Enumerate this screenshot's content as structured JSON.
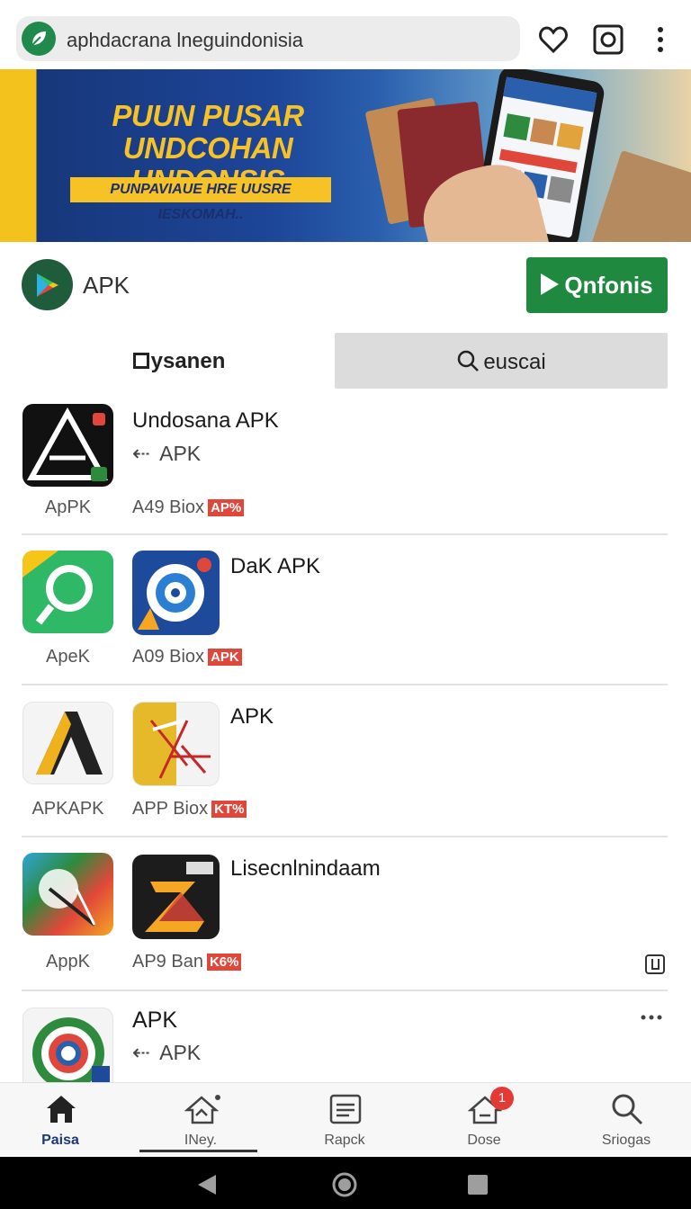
{
  "browser": {
    "url": "aphdacrana lneguindonisia"
  },
  "banner": {
    "title_line1": "PUUN PUSAR",
    "title_line2": "UNDCOHAN UNDONSIS",
    "tagline": "PUNPAVIAUE HRE UUSRE IESKOMAH.."
  },
  "app_header": {
    "name": "APK",
    "cta_label": "Qnfonis"
  },
  "tabs": {
    "left": "ysanen",
    "right": "euscai"
  },
  "list": [
    {
      "title": "Undosana APK",
      "subtitle": "APK",
      "icon_a_label": "ApPK",
      "meta_text": "A49 Biox",
      "meta_tag": "AP%"
    },
    {
      "title": "DaK APK",
      "icon_a_label": "ApeK",
      "meta_text": "A09 Biox",
      "meta_tag": "APK"
    },
    {
      "title": "APK",
      "icon_a_label": "APKAPK",
      "meta_text": "APP Biox",
      "meta_tag": "KT%"
    },
    {
      "title": "Lisecnlnindaam",
      "icon_a_label": "AppK",
      "meta_text": "AP9 Ban",
      "meta_tag": "K6%"
    },
    {
      "title": "APK",
      "subtitle": "APK"
    }
  ],
  "bottom_nav": [
    {
      "label": "Paisa",
      "icon": "home-icon",
      "active": true
    },
    {
      "label": "INey.",
      "icon": "house-outline-icon"
    },
    {
      "label": "Rapck",
      "icon": "document-icon"
    },
    {
      "label": "Dose",
      "icon": "notification-icon",
      "badge": "1"
    },
    {
      "label": "Sriogas",
      "icon": "search-icon"
    }
  ],
  "colors": {
    "accent_green": "#1f8a3f",
    "banner_blue": "#1d4598",
    "banner_yellow": "#f6c226",
    "tag_red": "#e0473a"
  }
}
